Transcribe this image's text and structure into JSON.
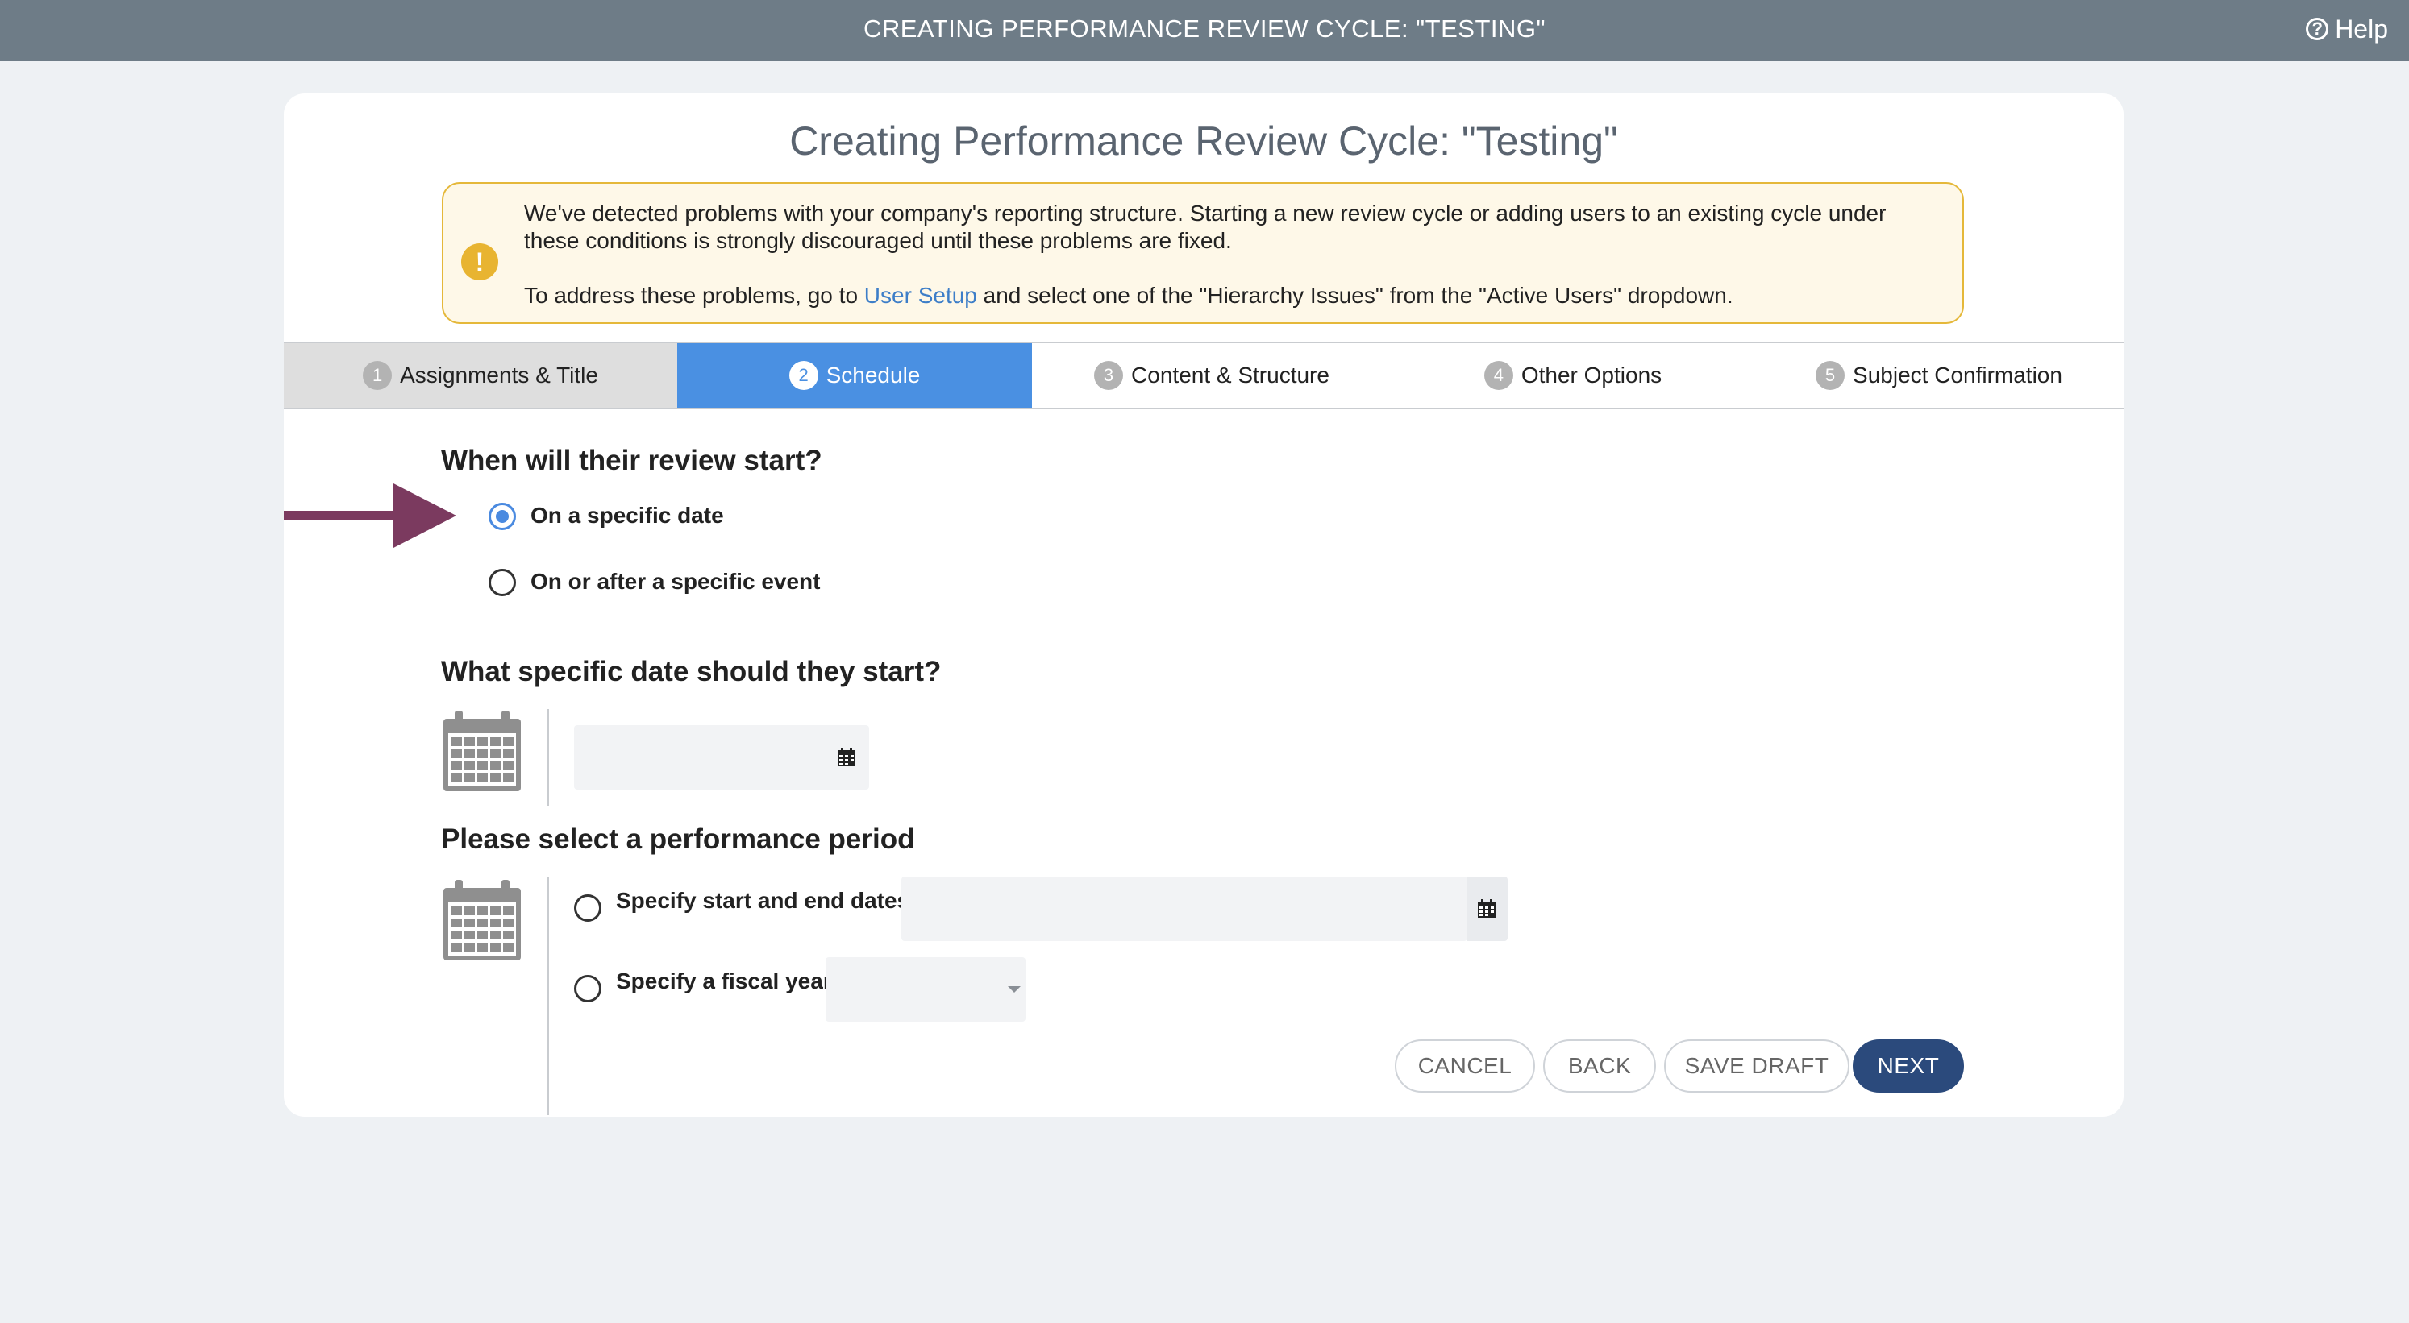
{
  "topbar": {
    "title": "CREATING PERFORMANCE REVIEW CYCLE: \"TESTING\"",
    "help_label": "Help",
    "help_icon": "question-circle-icon"
  },
  "page": {
    "title": "Creating Performance Review Cycle: \"Testing\""
  },
  "warning": {
    "icon": "exclamation-icon",
    "message": "We've detected problems with your company's reporting structure. Starting a new review cycle or adding users to an existing cycle under these conditions is strongly discouraged until these problems are fixed.",
    "address_prefix": "To address these problems, go to ",
    "link_text": "User Setup",
    "address_suffix": " and select one of the \"Hierarchy Issues\" from the \"Active Users\" dropdown."
  },
  "tabs": [
    {
      "num": "1",
      "label": "Assignments & Title"
    },
    {
      "num": "2",
      "label": "Schedule"
    },
    {
      "num": "3",
      "label": "Content & Structure"
    },
    {
      "num": "4",
      "label": "Other Options"
    },
    {
      "num": "5",
      "label": "Subject Confirmation"
    }
  ],
  "review_start": {
    "heading": "When will their review start?",
    "options": [
      {
        "label": "On a specific date",
        "selected": true
      },
      {
        "label": "On or after a specific event",
        "selected": false
      }
    ]
  },
  "start_date": {
    "heading": "What specific date should they start?",
    "value": ""
  },
  "performance_period": {
    "heading": "Please select a performance period",
    "options": [
      {
        "label": "Specify start and end dates",
        "selected": false
      },
      {
        "label": "Specify a fiscal year",
        "selected": false
      }
    ],
    "date_range_value": "",
    "fiscal_year_value": ""
  },
  "buttons": {
    "cancel": "CANCEL",
    "back": "BACK",
    "save_draft": "SAVE DRAFT",
    "next": "NEXT"
  },
  "colors": {
    "accent": "#4a90e2",
    "primary_button": "#2b4a7c",
    "arrow": "#7b3a5f",
    "warning_border": "#e5b83a"
  }
}
